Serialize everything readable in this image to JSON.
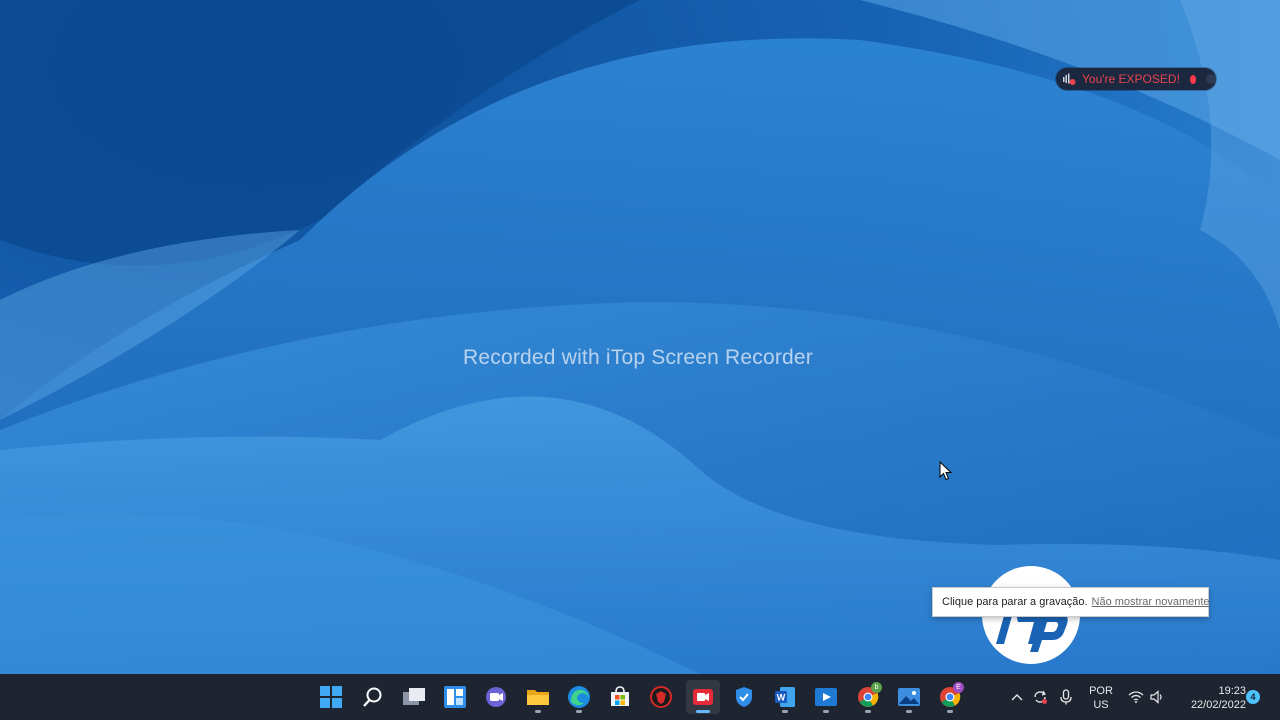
{
  "watermark": {
    "text": "Recorded with iTop Screen Recorder"
  },
  "recorder_overlay": {
    "status_text": "You're EXPOSED!"
  },
  "toast": {
    "message": "Clique para parar a gravação.",
    "link_text": "Não mostrar novamente"
  },
  "taskbar": {
    "apps": [
      {
        "name": "start",
        "icon": "windows-logo-icon"
      },
      {
        "name": "search",
        "icon": "search-icon"
      },
      {
        "name": "task-view",
        "icon": "task-view-icon"
      },
      {
        "name": "widgets",
        "icon": "widgets-icon"
      },
      {
        "name": "chat",
        "icon": "teams-chat-icon"
      },
      {
        "name": "file-explorer",
        "icon": "folder-icon"
      },
      {
        "name": "edge",
        "icon": "edge-icon"
      },
      {
        "name": "store",
        "icon": "store-icon"
      },
      {
        "name": "antivirus",
        "icon": "red-shield-app-icon"
      },
      {
        "name": "screen-recorder",
        "icon": "recorder-icon"
      },
      {
        "name": "defender",
        "icon": "shield-icon"
      },
      {
        "name": "word",
        "icon": "word-icon"
      },
      {
        "name": "media-player",
        "icon": "media-player-icon"
      },
      {
        "name": "chrome-profile-b",
        "icon": "chrome-icon",
        "badge": "b"
      },
      {
        "name": "photos",
        "icon": "photos-icon"
      },
      {
        "name": "chrome-profile-e",
        "icon": "chrome-icon",
        "badge": "E"
      }
    ],
    "active_app": "screen-recorder"
  },
  "tray": {
    "language_line1": "POR",
    "language_line2": "US",
    "time": "19:23",
    "date": "22/02/2022",
    "notification_count": "4"
  },
  "colors": {
    "taskbar_bg": "#1e2430",
    "accent": "#4cc2ff",
    "exposed_red": "#e8444e"
  }
}
